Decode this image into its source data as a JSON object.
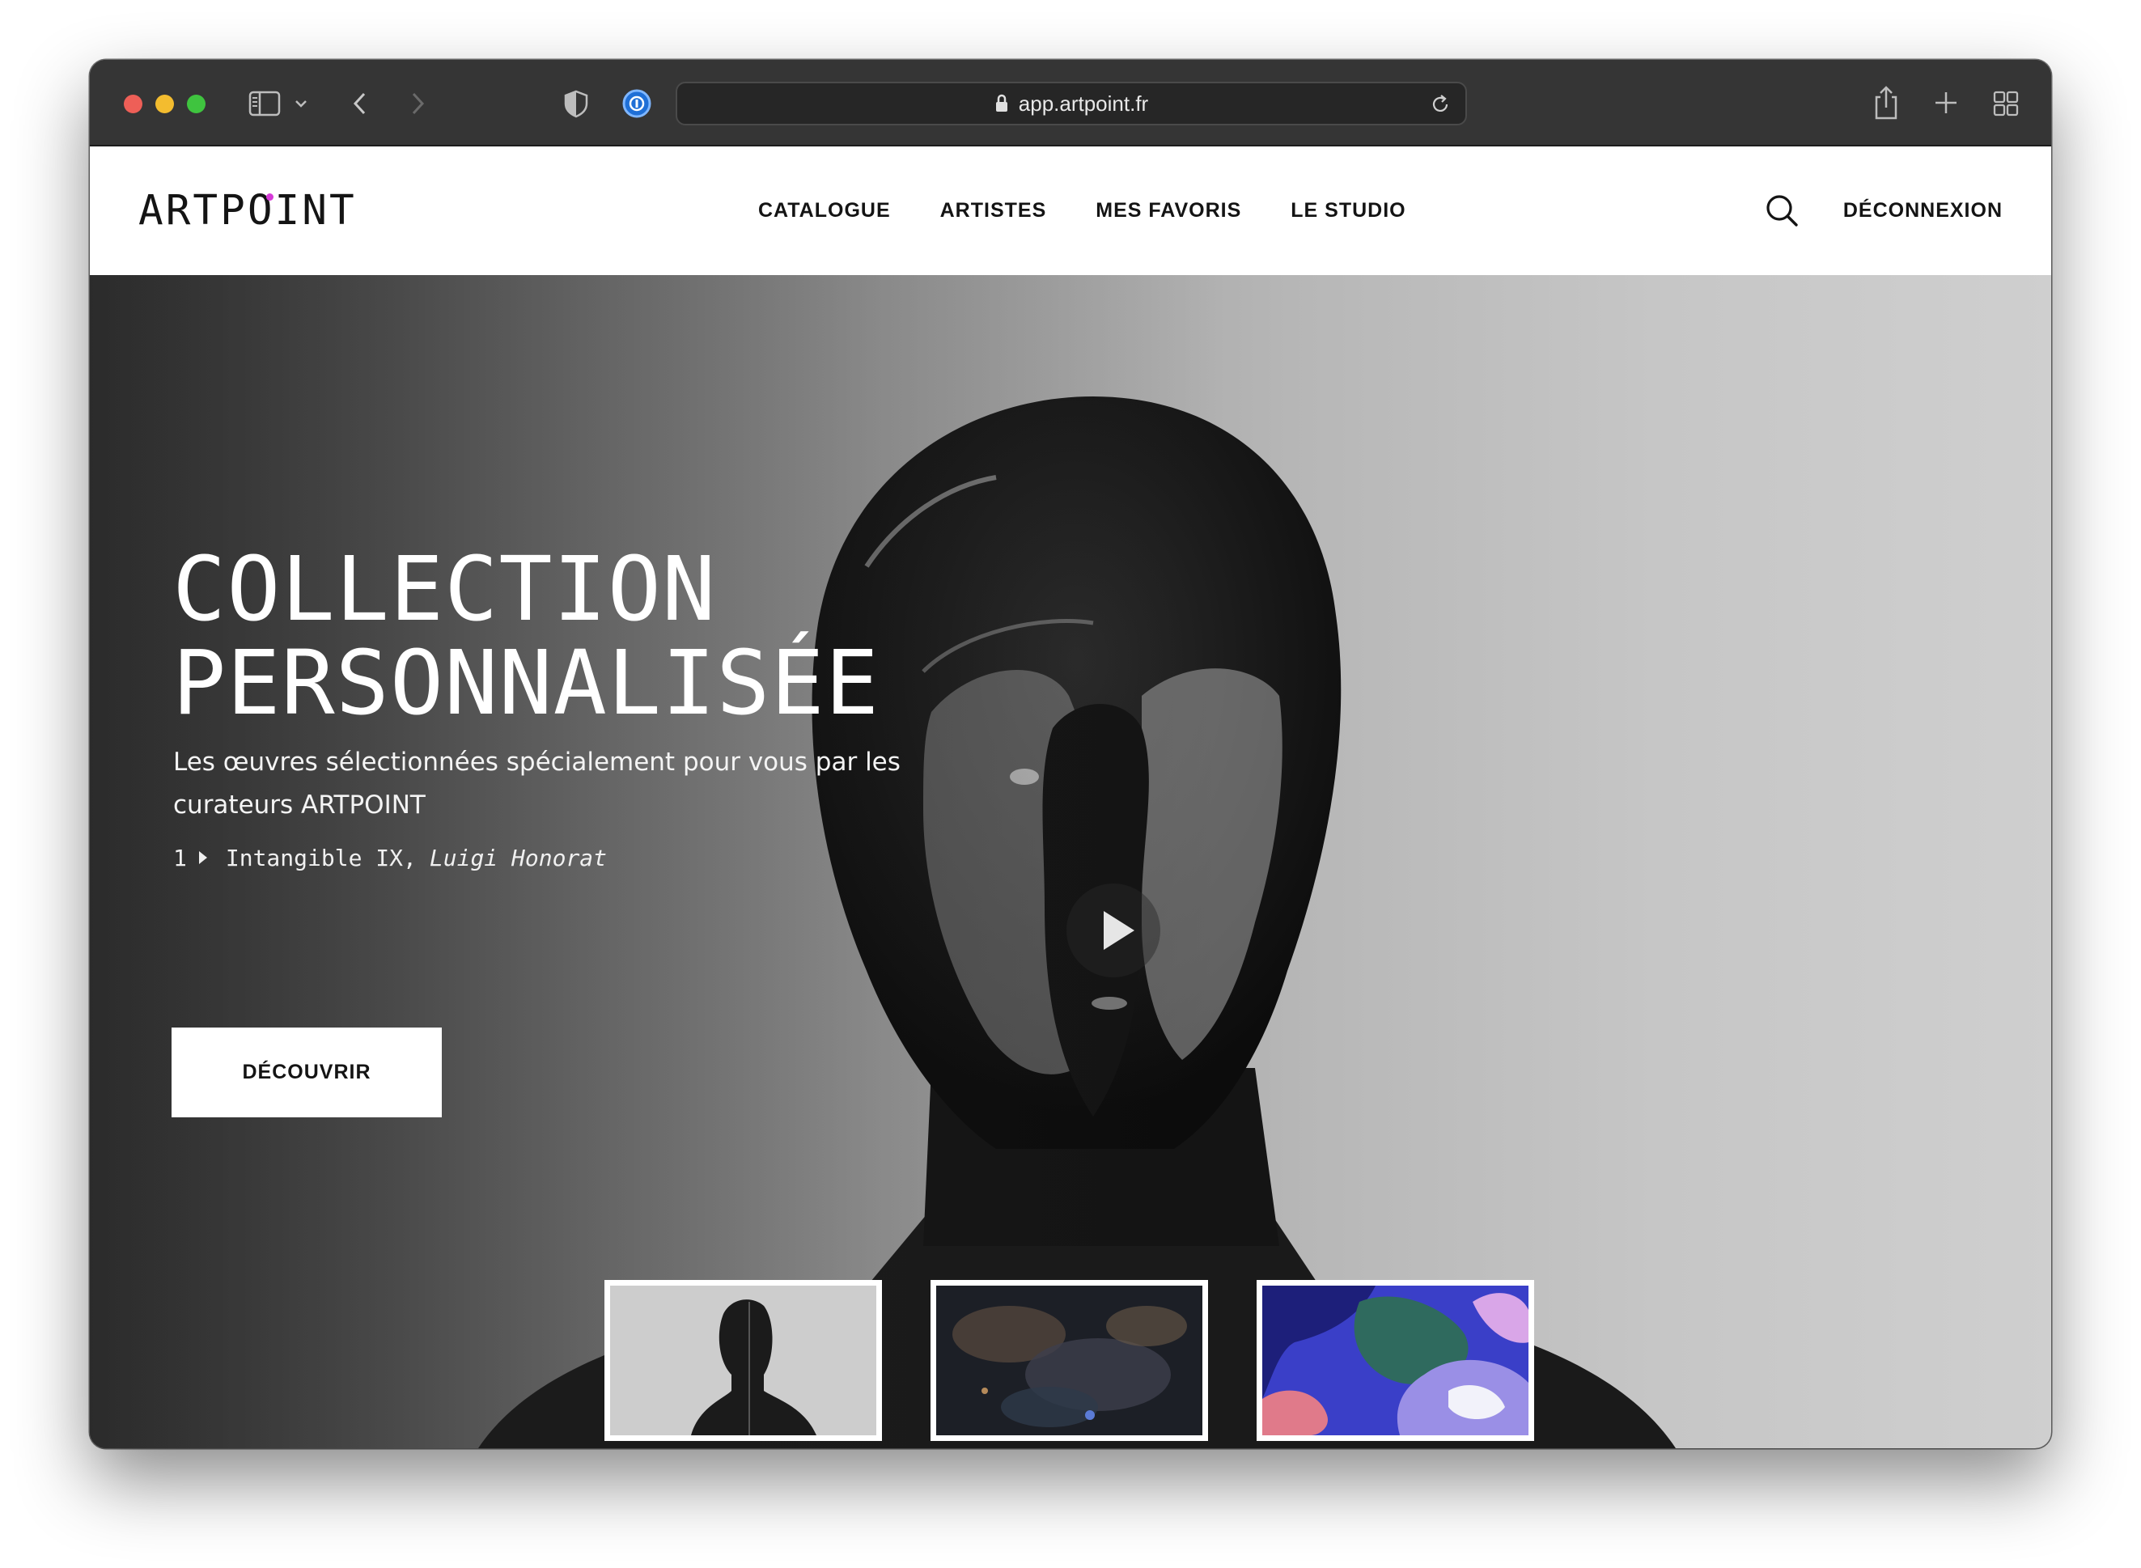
{
  "browser": {
    "url": "app.artpoint.fr"
  },
  "header": {
    "logo_text": "ARTPOINT",
    "logo_accent_color": "#d63ad8",
    "nav": [
      {
        "label": "CATALOGUE"
      },
      {
        "label": "ARTISTES"
      },
      {
        "label": "MES FAVORIS"
      },
      {
        "label": "LE STUDIO"
      }
    ],
    "logout_label": "DÉCONNEXION"
  },
  "hero": {
    "title_line1": "COLLECTION",
    "title_line2": "PERSONNALISÉE",
    "subtitle": "Les œuvres sélectionnées spécialement pour vous par les curateurs ARTPOINT",
    "index": "1",
    "artwork_title": "Intangible IX,",
    "artist": "Luigi Honorat",
    "cta_label": "DÉCOUVRIR"
  },
  "icons": {
    "lock": "lock-icon",
    "reload": "reload-icon",
    "search": "search-icon",
    "play": "play-icon"
  }
}
